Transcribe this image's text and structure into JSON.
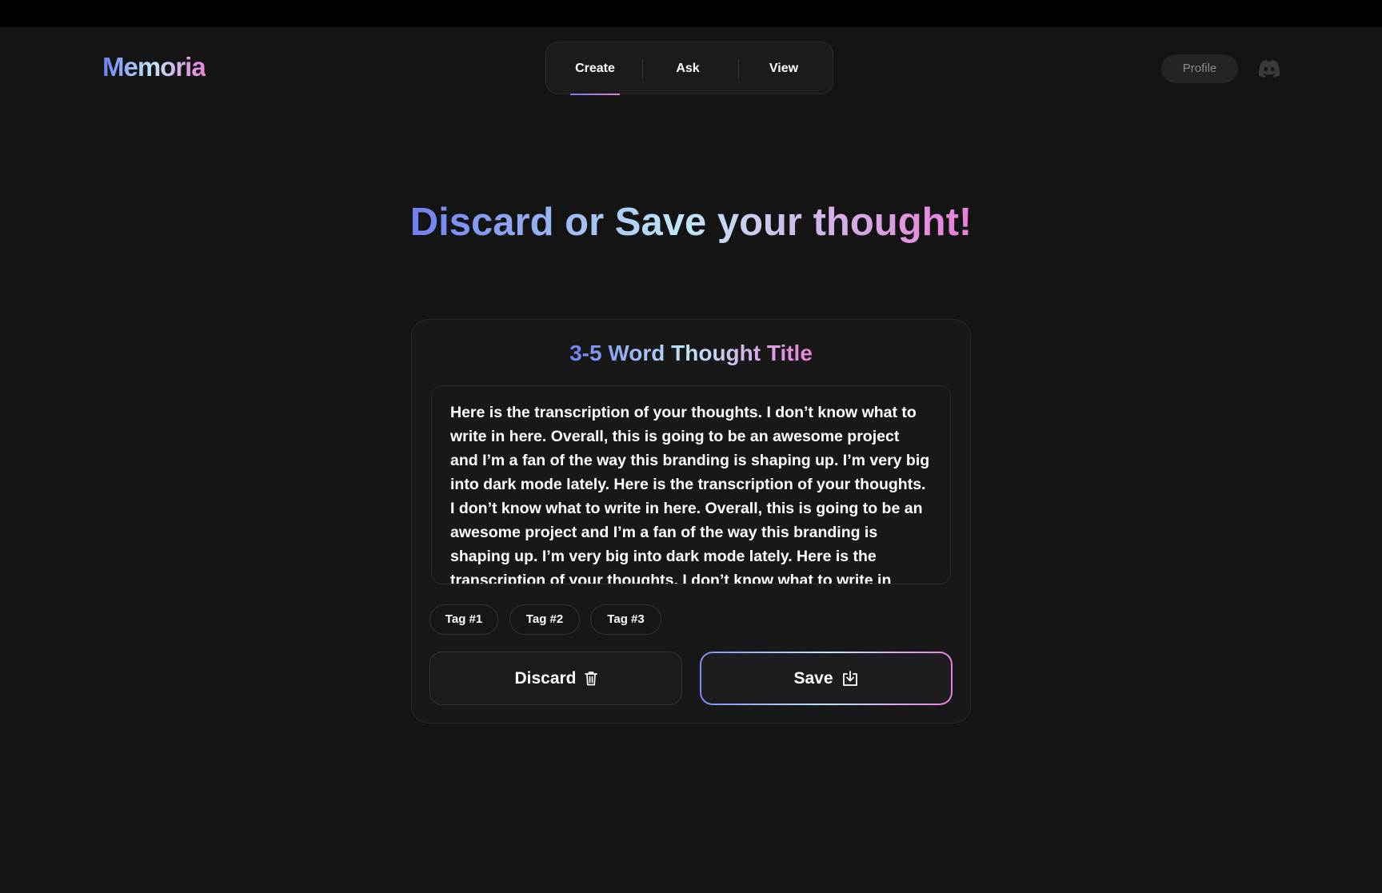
{
  "app": {
    "logo": "Memoria"
  },
  "nav": {
    "tabs": [
      {
        "label": "Create",
        "active": true
      },
      {
        "label": "Ask",
        "active": false
      },
      {
        "label": "View",
        "active": false
      }
    ]
  },
  "header": {
    "profile_label": "Profile",
    "discord_icon": "discord-icon"
  },
  "headline": {
    "text": "Discard or Save your thought!"
  },
  "card": {
    "title": "3-5 Word Thought Title",
    "transcript": "Here is the transcription of your thoughts. I don’t know what to write in here. Overall, this is going to be an awesome project and I’m a fan of the way this branding is shaping up. I’m very big into dark mode lately. Here is the transcription of your thoughts. I don’t know what to write in here. Overall, this is going to be an awesome project and I’m a fan of the way this branding is shaping up. I’m very big into dark mode lately. Here is the transcription of your thoughts. I don’t know what to write in here.",
    "tags": [
      "Tag #1",
      "Tag #2",
      "Tag #3"
    ],
    "discard_label": "Discard",
    "save_label": "Save"
  },
  "colors": {
    "background": "#141414",
    "gradient_start": "#6f7ff0",
    "gradient_mid": "#bfe5f7",
    "gradient_end": "#e77fd9"
  }
}
